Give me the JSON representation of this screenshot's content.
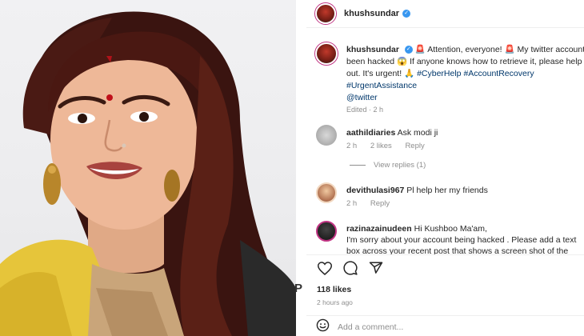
{
  "post": {
    "username": "khushsundar",
    "verified_glyph": "✓",
    "header_avatar": "avatar-icon"
  },
  "caption": {
    "username": "khushsundar",
    "text_part1": "Attention, everyone!",
    "text_part2": "My twitter account been hacked",
    "text_part3": "If anyone knows how to retrieve it, please help out. It's urgent!",
    "hashtag1": "#CyberHelp",
    "hashtag2": "#AccountRecovery",
    "hashtag3": "#UrgentAssistance",
    "mention": "@twitter",
    "edited": "Edited · 2 h"
  },
  "comments": [
    {
      "username": "aathildiaries",
      "text": "Ask modi ji",
      "time": "2 h",
      "likes": "2 likes",
      "reply": "Reply"
    },
    {
      "username": "devithulasi967",
      "text": "Pl help her my friends",
      "time": "2 h",
      "reply": "Reply"
    },
    {
      "username": "razinazainudeen",
      "text": "Hi Kushboo Ma'am,",
      "text2": "I'm sorry about your account being hacked . Please add a text box across your recent post that shows a screen shot of the"
    }
  ],
  "view_replies": "View replies (1)",
  "footer": {
    "likes": "118 likes",
    "time_ago": "2 hours ago",
    "add_comment_placeholder": "Add a comment..."
  },
  "watermark": "P",
  "colors": {
    "link": "#00376b",
    "verified": "#3897f0",
    "muted": "#8e8e8e",
    "siren": "#e0245e"
  }
}
